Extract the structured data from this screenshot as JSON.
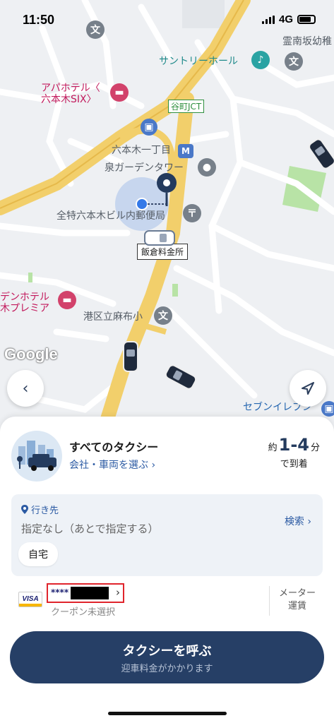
{
  "status_bar": {
    "time": "11:50",
    "network": "4G"
  },
  "map": {
    "labels": {
      "apa_hotel": "アパホテル〈\n六本木SIX〉",
      "suntory_hall": "サントリーホール",
      "reinanzaka": "霊南坂幼稚",
      "roppongi_1": "六本木一丁目",
      "izumi_garden": "泉ガーデンタワー",
      "post_office": "全特六本木ビル内郵便局",
      "den_hotel": "デンホテル\n木プレミア",
      "azabu_school": "港区立麻布小",
      "seven_eleven": "セブンイレブン"
    },
    "jct_label": "谷町JCT",
    "toll_gate": "飯倉料金所",
    "google_logo": "Google",
    "poi_icon_text": "文"
  },
  "sheet": {
    "taxi_title": "すべてのタクシー",
    "taxi_sub": "会社・車両を選ぶ ›",
    "eta": {
      "approx": "約",
      "range": "1-4",
      "unit": "分",
      "arrive": "で到着"
    },
    "destination": {
      "label": "行き先",
      "value": "指定なし（あとで指定する）",
      "search": "検索 ›",
      "home_chip": "自宅"
    },
    "payment": {
      "card_brand": "VISA",
      "card_masked": "****",
      "coupon": "クーポン未選択",
      "meter": "メーター\n運賃"
    },
    "call_button": {
      "main": "タクシーを呼ぶ",
      "sub": "迎車料金がかかります"
    }
  },
  "colors": {
    "primary": "#263f66",
    "link": "#2b5aa3",
    "highlight": "#e0242c",
    "expressway": "#f2cf6b"
  }
}
